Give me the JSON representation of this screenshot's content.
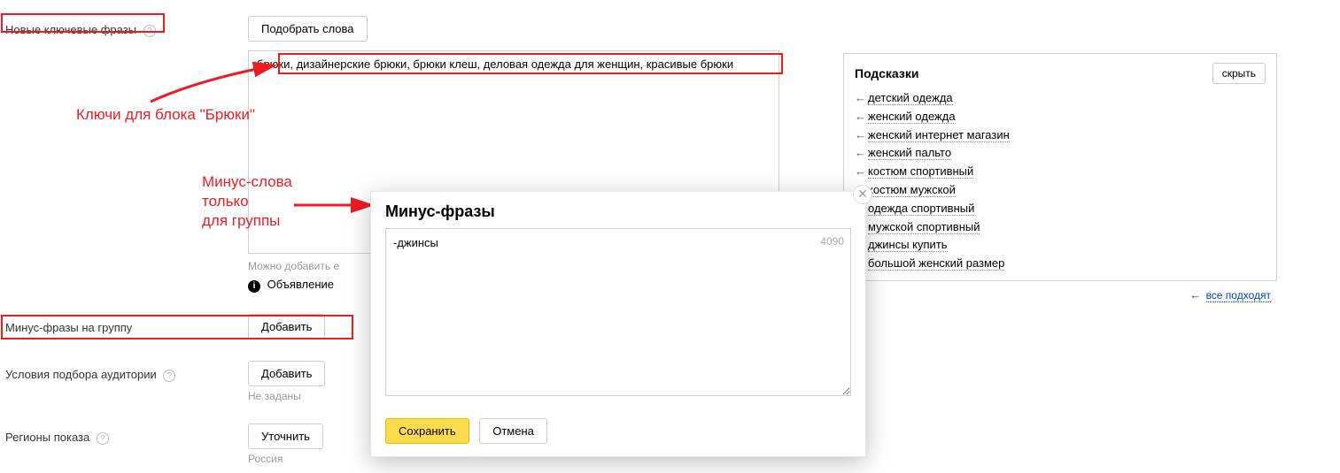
{
  "labels": {
    "newKeywords": "Новые ключевые фразы",
    "minusPhrasesGroup": "Минус-фразы на группу",
    "audienceConditions": "Условия подбора аудитории",
    "displayRegions": "Регионы показа"
  },
  "buttons": {
    "pickWords": "Подобрать слова",
    "add": "Добавить",
    "clarify": "Уточнить",
    "save": "Сохранить",
    "cancel": "Отмена",
    "hide": "скрыть"
  },
  "keywords": {
    "value": "брюки, дизайнерские брюки, брюки клеш, деловая одежда для женщин, красивые брюки",
    "hint": "Можно добавить е",
    "adInfo": "Объявление"
  },
  "audience": {
    "hint": "Не заданы"
  },
  "regions": {
    "value": "Россия"
  },
  "suggestions": {
    "title": "Подсказки",
    "items": [
      "детский одежда",
      "женский одежда",
      "женский интернет магазин",
      "женский пальто",
      "костюм спортивный",
      "костюм мужской",
      "одежда спортивный",
      "мужской спортивный",
      "джинсы купить",
      "большой женский размер"
    ],
    "allMatch": "все подходят"
  },
  "modal": {
    "title": "Минус-фразы",
    "value": "-джинсы",
    "charCount": "4090"
  },
  "annotations": {
    "keys": "Ключи для блока \"Брюки\"",
    "minusWords1": "Минус-слова",
    "minusWords2": "только",
    "minusWords3": "для группы"
  }
}
